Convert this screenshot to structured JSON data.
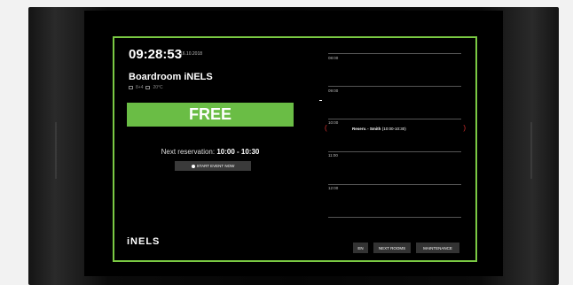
{
  "header": {
    "clock": "09:28:53",
    "date": "16.10.2018"
  },
  "room": {
    "name": "Boardroom iNELS",
    "amenities": [
      {
        "icon": "screen-icon",
        "text": "8+4"
      },
      {
        "icon": "temperature-icon",
        "text": "20°C"
      }
    ]
  },
  "status": {
    "label": "FREE",
    "color": "#6abd45"
  },
  "next_reservation": {
    "label": "Next reservation:",
    "time": "10:00 - 10:30"
  },
  "start_button": {
    "label": "START EVENT NOW"
  },
  "brand": {
    "logo": "iNELS",
    "accent": "#7ac943"
  },
  "schedule": {
    "slots": [
      "08:00",
      "09:00",
      "10:00",
      "11:00",
      "12:00"
    ],
    "reservation": {
      "text": "Reserv. - Smith",
      "sub": "(10:00-10:30)",
      "bracket_color": "#e03030"
    }
  },
  "footer": {
    "lang_button": "EN",
    "next_rooms_button": "NEXT ROOMS",
    "maintenance_button": "MAINTENANCE"
  }
}
